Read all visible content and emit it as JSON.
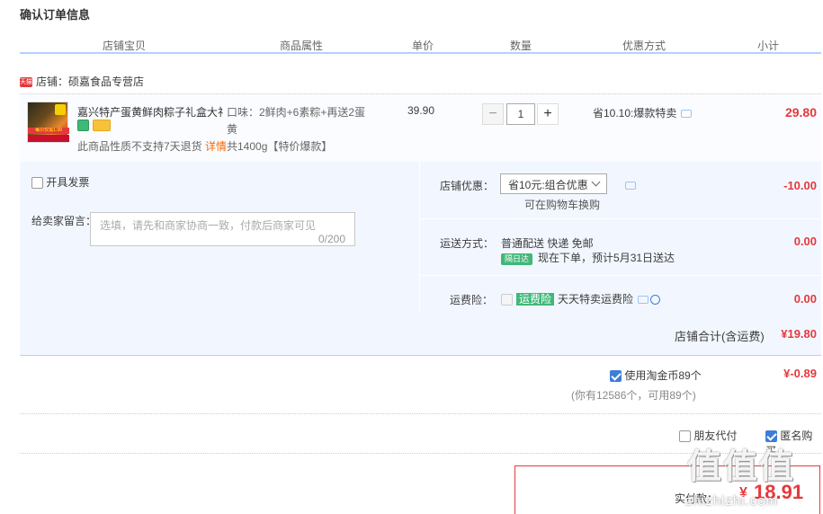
{
  "page_title": "确认订单信息",
  "columns": [
    "店铺宝贝",
    "商品属性",
    "单价",
    "数量",
    "优惠方式",
    "小计"
  ],
  "shop": {
    "tag": "天猫",
    "label": "店铺：硕嘉食品专营店"
  },
  "item": {
    "name": "嘉兴特产蛋黄鲜肉粽子礼盒大礼...",
    "image_text": "每只仅需1.99",
    "attr_line1": "口味：2鲜肉+6素粽+再送2蛋黄",
    "attr_line2": "共1400g【特价爆款】",
    "price": "39.90",
    "qty": "1",
    "qty_minus": "−",
    "qty_plus": "+",
    "promo": "省10.10:爆款特卖",
    "subtotal": "29.80",
    "no_return": "此商品性质不支持7天退货",
    "detail_link": "详情"
  },
  "invoice_label": "开具发票",
  "message": {
    "label": "给卖家留言：",
    "placeholder": "选填，请先和商家协商一致，付款后商家可见",
    "count": "0/200"
  },
  "shop_discount": {
    "label": "店铺优惠：",
    "selected": "省10元:组合优惠",
    "hint": "可在购物车换购",
    "amount": "-10.00"
  },
  "shipping": {
    "label": "运送方式：",
    "method": "普通配送 快递 免邮",
    "badge": "隔日达",
    "eta": "现在下单，预计5月31日送达",
    "amount": "0.00"
  },
  "insurance": {
    "label": "运费险：",
    "badge": "运费险",
    "text": "天天特卖运费险",
    "amount": "0.00"
  },
  "shop_total": {
    "label": "店铺合计(含运费)",
    "amount": "¥19.80"
  },
  "coins": {
    "label": "使用淘金币89个",
    "amount": "¥-0.89",
    "note": "(你有12586个，可用89个)"
  },
  "friend_pay": "朋友代付",
  "anon_buy": "匿名购买",
  "pay": {
    "label": "实付款：",
    "currency": "¥",
    "amount": "18.91"
  },
  "watermark": {
    "logo": "值值值",
    "site": "zhizhizhi.com"
  },
  "colors": {
    "accent_red": "#e4393c",
    "link_blue": "#3d7ed8",
    "panel_bg": "#f2f7ff",
    "green_badge": "#3fb878"
  }
}
